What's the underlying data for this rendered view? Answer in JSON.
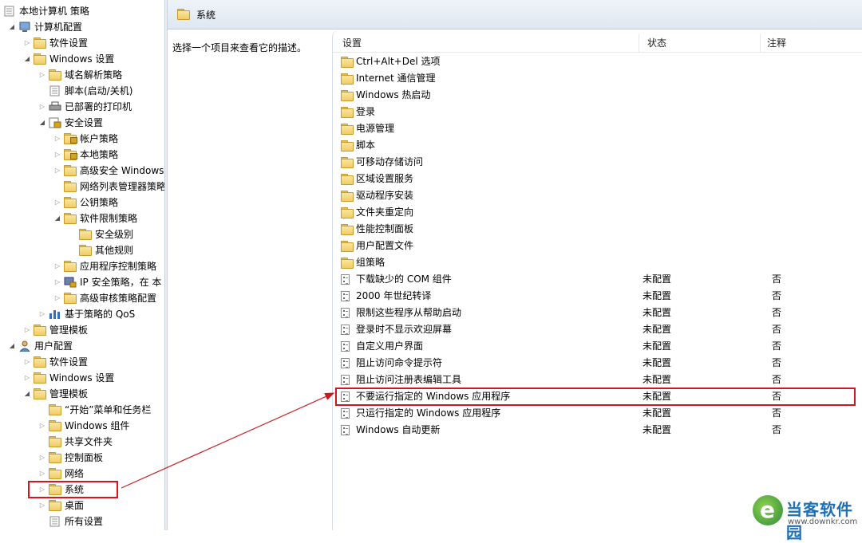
{
  "tree": {
    "items": [
      {
        "label": "本地计算机 策略",
        "icon": "policy-doc-icon",
        "exp": ""
      },
      {
        "label": "计算机配置",
        "icon": "computer-icon",
        "exp": "open"
      },
      {
        "label": "软件设置",
        "icon": "folder-icon",
        "exp": "closed"
      },
      {
        "label": "Windows 设置",
        "icon": "folder-icon",
        "exp": "open"
      },
      {
        "label": "域名解析策略",
        "icon": "folder-icon",
        "exp": "closed"
      },
      {
        "label": "脚本(启动/关机)",
        "icon": "script-icon",
        "exp": ""
      },
      {
        "label": "已部署的打印机",
        "icon": "printer-icon",
        "exp": "closed"
      },
      {
        "label": "安全设置",
        "icon": "security-icon",
        "exp": "open"
      },
      {
        "label": "帐户策略",
        "icon": "lock-folder-icon",
        "exp": "closed"
      },
      {
        "label": "本地策略",
        "icon": "lock-folder-icon",
        "exp": "closed"
      },
      {
        "label": "高级安全 Windows",
        "icon": "folder-icon",
        "exp": "closed"
      },
      {
        "label": "网络列表管理器策略",
        "icon": "folder-icon",
        "exp": ""
      },
      {
        "label": "公钥策略",
        "icon": "folder-icon",
        "exp": "closed"
      },
      {
        "label": "软件限制策略",
        "icon": "folder-icon",
        "exp": "open"
      },
      {
        "label": "安全级别",
        "icon": "folder-icon",
        "exp": ""
      },
      {
        "label": "其他规则",
        "icon": "folder-icon",
        "exp": ""
      },
      {
        "label": "应用程序控制策略",
        "icon": "folder-icon",
        "exp": "closed"
      },
      {
        "label": "IP 安全策略，在 本",
        "icon": "ip-security-icon",
        "exp": "closed"
      },
      {
        "label": "高级审核策略配置",
        "icon": "folder-icon",
        "exp": "closed"
      },
      {
        "label": "基于策略的 QoS",
        "icon": "qos-chart-icon",
        "exp": "closed"
      },
      {
        "label": "管理模板",
        "icon": "folder-icon",
        "exp": "closed"
      },
      {
        "label": "用户配置",
        "icon": "user-icon",
        "exp": "open"
      },
      {
        "label": "软件设置",
        "icon": "folder-icon",
        "exp": "closed"
      },
      {
        "label": "Windows 设置",
        "icon": "folder-icon",
        "exp": "closed"
      },
      {
        "label": "管理模板",
        "icon": "folder-icon",
        "exp": "open"
      },
      {
        "label": "“开始”菜单和任务栏",
        "icon": "folder-icon",
        "exp": ""
      },
      {
        "label": "Windows 组件",
        "icon": "folder-icon",
        "exp": "closed"
      },
      {
        "label": "共享文件夹",
        "icon": "folder-icon",
        "exp": ""
      },
      {
        "label": "控制面板",
        "icon": "folder-icon",
        "exp": "closed"
      },
      {
        "label": "网络",
        "icon": "folder-icon",
        "exp": "closed"
      },
      {
        "label": "系统",
        "icon": "folder-icon",
        "exp": "closed"
      },
      {
        "label": "桌面",
        "icon": "folder-icon",
        "exp": "closed"
      },
      {
        "label": "所有设置",
        "icon": "all-settings-icon",
        "exp": ""
      }
    ]
  },
  "header": {
    "title": "系统"
  },
  "description": {
    "text": "选择一个项目来查看它的描述。"
  },
  "list": {
    "columns": {
      "setting": "设置",
      "state": "状态",
      "note": "注释"
    },
    "rows": [
      {
        "name": "Ctrl+Alt+Del 选项",
        "type": "folder",
        "state": "",
        "note": ""
      },
      {
        "name": "Internet 通信管理",
        "type": "folder",
        "state": "",
        "note": ""
      },
      {
        "name": "Windows 热启动",
        "type": "folder",
        "state": "",
        "note": ""
      },
      {
        "name": "登录",
        "type": "folder",
        "state": "",
        "note": ""
      },
      {
        "name": "电源管理",
        "type": "folder",
        "state": "",
        "note": ""
      },
      {
        "name": "脚本",
        "type": "folder",
        "state": "",
        "note": ""
      },
      {
        "name": "可移动存储访问",
        "type": "folder",
        "state": "",
        "note": ""
      },
      {
        "name": "区域设置服务",
        "type": "folder",
        "state": "",
        "note": ""
      },
      {
        "name": "驱动程序安装",
        "type": "folder",
        "state": "",
        "note": ""
      },
      {
        "name": "文件夹重定向",
        "type": "folder",
        "state": "",
        "note": ""
      },
      {
        "name": "性能控制面板",
        "type": "folder",
        "state": "",
        "note": ""
      },
      {
        "name": "用户配置文件",
        "type": "folder",
        "state": "",
        "note": ""
      },
      {
        "name": "组策略",
        "type": "folder",
        "state": "",
        "note": ""
      },
      {
        "name": "下载缺少的 COM 组件",
        "type": "setting",
        "state": "未配置",
        "note": "否"
      },
      {
        "name": "2000 年世纪转译",
        "type": "setting",
        "state": "未配置",
        "note": "否"
      },
      {
        "name": "限制这些程序从帮助启动",
        "type": "setting",
        "state": "未配置",
        "note": "否"
      },
      {
        "name": "登录时不显示欢迎屏幕",
        "type": "setting",
        "state": "未配置",
        "note": "否"
      },
      {
        "name": "自定义用户界面",
        "type": "setting",
        "state": "未配置",
        "note": "否"
      },
      {
        "name": "阻止访问命令提示符",
        "type": "setting",
        "state": "未配置",
        "note": "否"
      },
      {
        "name": "阻止访问注册表编辑工具",
        "type": "setting",
        "state": "未配置",
        "note": "否"
      },
      {
        "name": "不要运行指定的 Windows 应用程序",
        "type": "setting",
        "state": "未配置",
        "note": "否"
      },
      {
        "name": "只运行指定的 Windows 应用程序",
        "type": "setting",
        "state": "未配置",
        "note": "否"
      },
      {
        "name": "Windows 自动更新",
        "type": "setting",
        "state": "未配置",
        "note": "否"
      }
    ]
  },
  "watermark": {
    "name": "当客软件园",
    "url": "www.downkr.com"
  },
  "colors": {
    "highlight": "#d9151b",
    "header_bg": "#dfe7f1",
    "folder": "#f0cc64"
  }
}
